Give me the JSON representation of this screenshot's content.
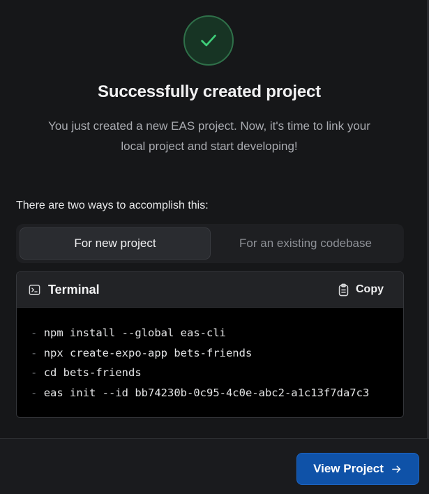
{
  "header": {
    "badge_icon": "check-icon",
    "title": "Successfully created project",
    "subtitle": "You just created a new EAS project. Now, it's time to link your local project and start developing!"
  },
  "ways": {
    "label": "There are two ways to accomplish this:",
    "tabs": [
      {
        "label": "For new project",
        "active": true
      },
      {
        "label": "For an existing codebase",
        "active": false
      }
    ]
  },
  "terminal": {
    "icon": "terminal-icon",
    "title": "Terminal",
    "copy_icon": "clipboard-icon",
    "copy_label": "Copy",
    "prefix": "-",
    "commands": [
      "npm install --global eas-cli",
      "npx create-expo-app bets-friends",
      "cd bets-friends",
      "eas init --id bb74230b-0c95-4c0e-abc2-a1c13f7da7c3"
    ]
  },
  "footer": {
    "view_project_label": "View Project",
    "view_project_icon": "arrow-right-icon"
  },
  "colors": {
    "background": "#161719",
    "success_green": "#3fcf7a",
    "primary_blue": "#0f52a8"
  }
}
